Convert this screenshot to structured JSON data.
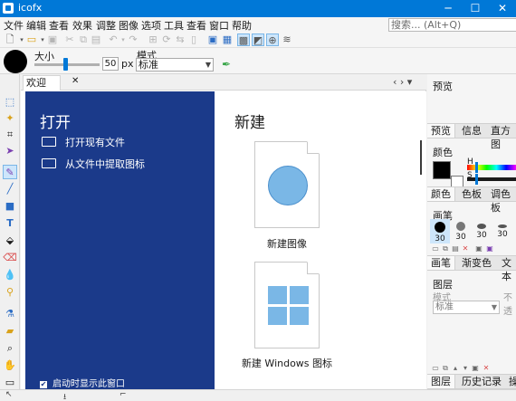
{
  "window": {
    "title": "icofx",
    "minimize": "─",
    "maximize": "☐",
    "close": "✕"
  },
  "menu": [
    "文件",
    "编辑",
    "查看",
    "效果",
    "调整",
    "图像",
    "选项",
    "工具",
    "查看",
    "窗口",
    "帮助"
  ],
  "search": {
    "placeholder": "搜索... (Alt+Q)"
  },
  "brush_options": {
    "size_label": "大小",
    "size_value": "50",
    "size_unit": "px",
    "size_fraction": 0.47,
    "mode_label": "模式",
    "mode_value": "标准"
  },
  "tabs": [
    {
      "label": "欢迎",
      "close": "✕"
    }
  ],
  "tab_nav": "‹  ›  ▾",
  "welcome": {
    "open_title": "打开",
    "open_items": [
      "打开现有文件",
      "从文件中提取图标"
    ],
    "show_on_start": "启动时显示此窗口",
    "new_title": "新建",
    "new_items": [
      "新建图像",
      "新建 Windows 图标"
    ]
  },
  "right_panel": {
    "preview_label": "预览",
    "preview_tabs": [
      "预览",
      "信息",
      "直方图"
    ],
    "color_label": "颜色",
    "h_label": "H",
    "s_label": "S",
    "color_tabs": [
      "颜色",
      "色板",
      "调色板"
    ],
    "brush_label": "画笔",
    "brush_sizes": [
      "30",
      "30",
      "30",
      "30"
    ],
    "brush_tabs": [
      "画笔",
      "渐变色",
      "文本"
    ],
    "layer_label": "图层",
    "layer_mode_label": "模式",
    "layer_opacity_label": "不透",
    "layer_mode_value": "标准",
    "layer_tabs": [
      "图层",
      "历史记录",
      "操"
    ]
  },
  "colors": {
    "accent": "#0078d7",
    "welcome_panel": "#1b3a8a",
    "primary_color": "#000000",
    "secondary_color": "#ffffff",
    "icon_fill": "#7ab7e6"
  }
}
